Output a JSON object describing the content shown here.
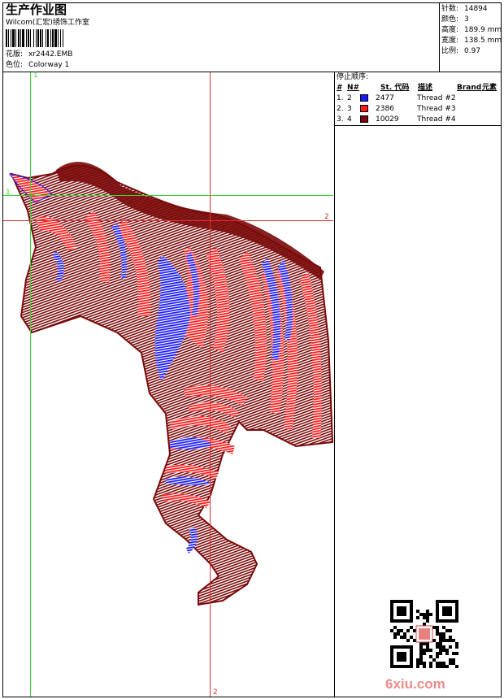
{
  "header": {
    "title": "生产作业图",
    "company": "Wilcom(汇宏)绣饰工作室",
    "design_label": "花版:",
    "design_value": "xr2442.EMB",
    "colorway_label": "色位:",
    "colorway_value": "Colorway 1"
  },
  "stats": {
    "stitches_label": "针数:",
    "stitches_value": "14894",
    "colors_label": "颜色:",
    "colors_value": "3",
    "height_label": "高度:",
    "height_value": "189.9 mm",
    "width_label": "宽度:",
    "width_value": "138.5 mm",
    "scale_label": "比例:",
    "scale_value": "0.97"
  },
  "sequence": {
    "title": "停止顺序:",
    "headers": {
      "order": "#",
      "needle": "N#",
      "code": "St. 代码",
      "desc": "描述",
      "brand": "Brand",
      "element": "元素"
    },
    "rows": [
      {
        "order": "1.",
        "needle": "2",
        "color": "#1a1aff",
        "code": "2477",
        "desc": "Thread #2"
      },
      {
        "order": "2.",
        "needle": "3",
        "color": "#ff1a1a",
        "code": "2386",
        "desc": "Thread #3"
      },
      {
        "order": "3.",
        "needle": "4",
        "color": "#7a0a0a",
        "code": "10029",
        "desc": "Thread #4"
      }
    ]
  },
  "guides": {
    "g1_top": "1",
    "g1_left": "1",
    "r2_right": "2",
    "r2_bottom": "2"
  },
  "watermark": {
    "text": "6xiu.com"
  },
  "colors": {
    "thread_blue": "#1a1aff",
    "thread_red": "#ff1a1a",
    "thread_brown": "#7a0a0a",
    "guide_green": "#35d435",
    "guide_red": "#e03030"
  }
}
